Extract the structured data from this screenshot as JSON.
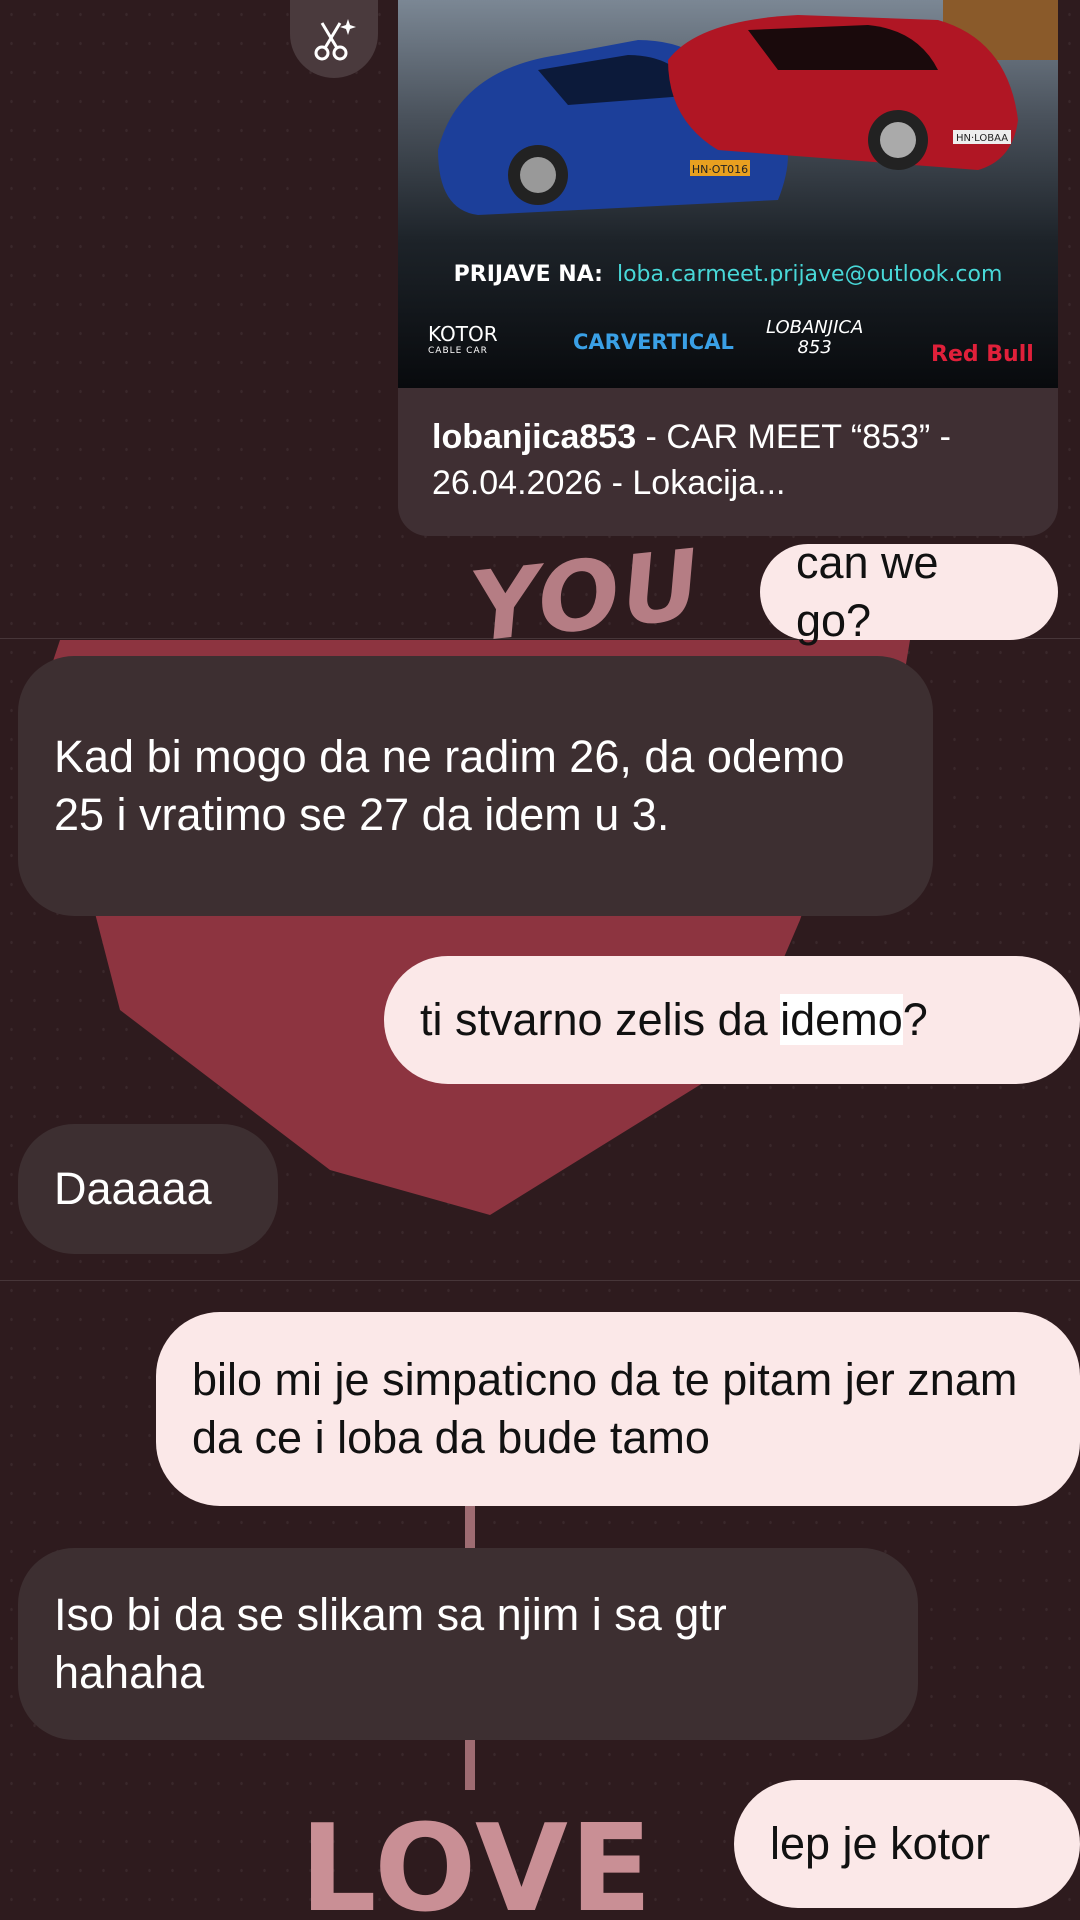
{
  "post": {
    "signup_label": "PRIJAVE NA:",
    "signup_email": "loba.carmeet.prijave@outlook.com",
    "plate_left": "HN·OT016",
    "plate_right": "HN·LOBAA",
    "sponsors": {
      "kotor": "KOTOR",
      "kotor_sub": "CABLE CAR",
      "carvertical": "CARVERTICAL",
      "lobanjica": "LOBANJICA",
      "lobanjica_num": "853",
      "redbull": "Red Bull"
    },
    "caption_user": "lobanjica853",
    "caption_text": " - CAR MEET “853” - 26.04.2026 - Lokacija..."
  },
  "wallpaper": {
    "word_top": "YOU",
    "word_bottom": "LOVE"
  },
  "messages": {
    "m1": "can we go?",
    "m2": "Kad bi mogo da ne radim 26, da odemo 25 i vratimo se 27 da idem u 3.",
    "m3_a": "ti stvarno zelis da ",
    "m3_hl": "idemo",
    "m3_b": "?",
    "m4": "Daaaaa",
    "m5": "bilo mi je simpaticno da te pitam jer znam da ce i loba da bude tamo",
    "m6": "Iso bi da se slikam sa njim i sa gtr hahaha",
    "m7": "lep je kotor"
  },
  "colors": {
    "background": "#2e1b1e",
    "sent_bubble": "#fbe8e8",
    "received_bubble": "#3d2f31",
    "heart": "#8d3440"
  }
}
